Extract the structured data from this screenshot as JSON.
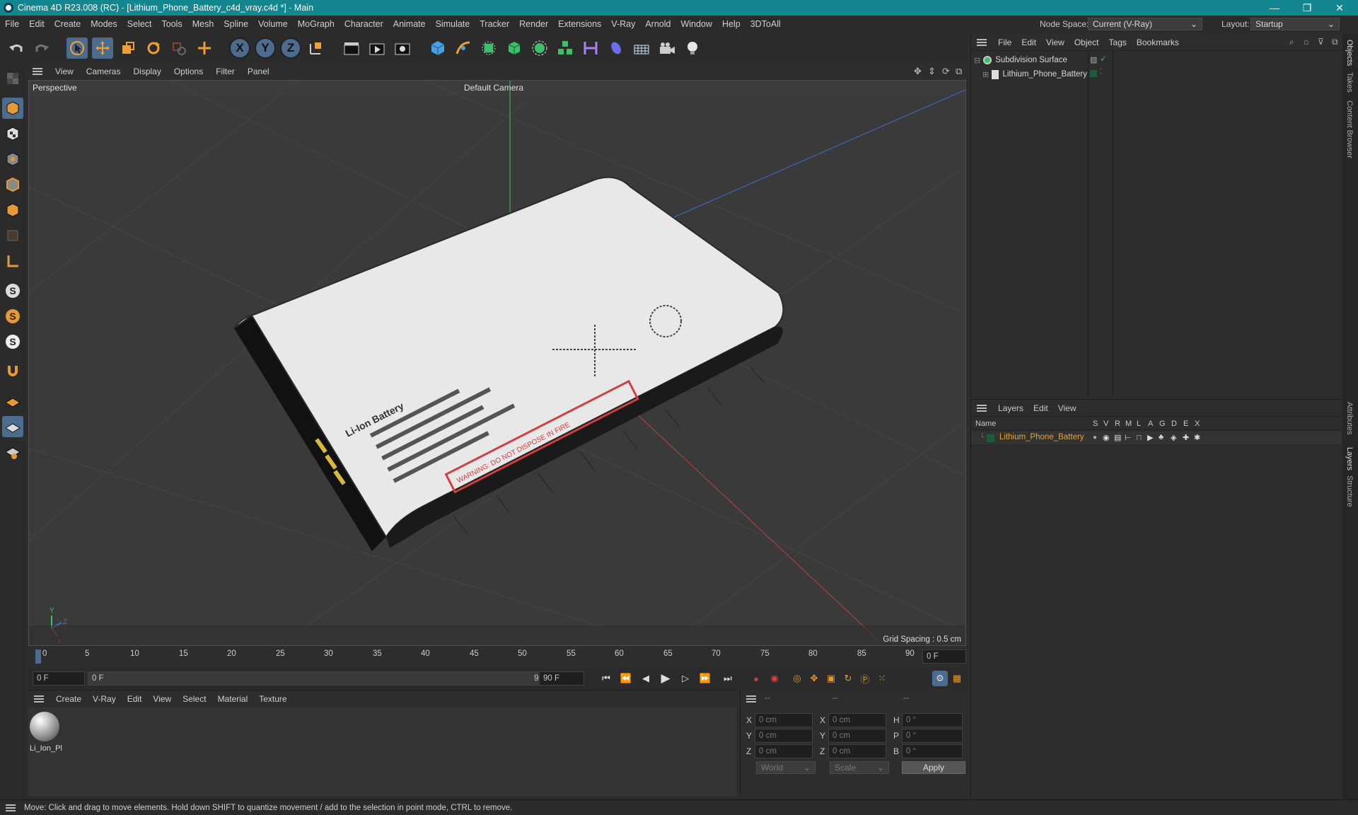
{
  "window": {
    "title": "Cinema 4D R23.008 (RC) - [Lithium_Phone_Battery_c4d_vray.c4d *] - Main",
    "minimize": "—",
    "restore": "❐",
    "close": "✕"
  },
  "menubar": {
    "items": [
      "File",
      "Edit",
      "Create",
      "Modes",
      "Select",
      "Tools",
      "Mesh",
      "Spline",
      "Volume",
      "MoGraph",
      "Character",
      "Animate",
      "Simulate",
      "Tracker",
      "Render",
      "Extensions",
      "V-Ray",
      "Arnold",
      "Window",
      "Help",
      "3DToAll"
    ],
    "node_space_label": "Node Space:",
    "node_space_value": "Current (V-Ray)",
    "layout_label": "Layout:",
    "layout_value": "Startup"
  },
  "toolbar": {
    "axis_x": "X",
    "axis_y": "Y",
    "axis_z": "Z"
  },
  "viewport": {
    "menu": [
      "View",
      "Cameras",
      "Display",
      "Options",
      "Filter",
      "Panel"
    ],
    "label": "Perspective",
    "camera": "Default Camera",
    "grid_spacing": "Grid Spacing : 0.5 cm",
    "axis_x": "X",
    "axis_y": "Y",
    "axis_z": "Z",
    "battery_text_1": "Li-Ion Battery",
    "battery_text_warning": "WARNING: DO NOT DISPOSE IN FIRE"
  },
  "timeline": {
    "ticks": [
      "0",
      "5",
      "10",
      "15",
      "20",
      "25",
      "30",
      "35",
      "40",
      "45",
      "50",
      "55",
      "60",
      "65",
      "70",
      "75",
      "80",
      "85",
      "90"
    ],
    "current_frame": "0 F"
  },
  "playback": {
    "start_field": "0 F",
    "slider_start": "0 F",
    "slider_end": "90 F",
    "end_field": "90 F"
  },
  "material_manager": {
    "menu": [
      "Create",
      "V-Ray",
      "Edit",
      "View",
      "Select",
      "Material",
      "Texture"
    ],
    "materials": [
      {
        "name": "Li_Ion_Pl"
      }
    ]
  },
  "coordinates": {
    "header": [
      "--",
      "--",
      "--"
    ],
    "rows": [
      {
        "a_label": "X",
        "a_val": "0 cm",
        "b_label": "X",
        "b_val": "0 cm",
        "c_label": "H",
        "c_val": "0 °"
      },
      {
        "a_label": "Y",
        "a_val": "0 cm",
        "b_label": "Y",
        "b_val": "0 cm",
        "c_label": "P",
        "c_val": "0 °"
      },
      {
        "a_label": "Z",
        "a_val": "0 cm",
        "b_label": "Z",
        "b_val": "0 cm",
        "c_label": "B",
        "c_val": "0 °"
      }
    ],
    "space_value": "World",
    "mode_value": "Scale",
    "apply_label": "Apply"
  },
  "object_manager": {
    "menu": [
      "File",
      "Edit",
      "View",
      "Object",
      "Tags",
      "Bookmarks"
    ],
    "objects": [
      {
        "name": "Subdivision Surface"
      },
      {
        "name": "Lithium_Phone_Battery"
      }
    ]
  },
  "layer_manager": {
    "menu": [
      "Layers",
      "Edit",
      "View"
    ],
    "name_header": "Name",
    "columns": [
      "S",
      "V",
      "R",
      "M",
      "L",
      "A",
      "G",
      "D",
      "E",
      "X"
    ],
    "layers": [
      {
        "name": "Lithium_Phone_Battery",
        "color": "#1d5c3a"
      }
    ]
  },
  "side_tabs": [
    "Objects",
    "Takes",
    "Content Browser",
    "Attributes",
    "Layers",
    "Structure"
  ],
  "status": {
    "text": "Move: Click and drag to move elements. Hold down SHIFT to quantize movement / add to the selection in point mode, CTRL to remove."
  },
  "colors": {
    "titlebar": "#13878f",
    "accent_blue": "#4b6c8e",
    "layer_name": "#e8a13c"
  }
}
